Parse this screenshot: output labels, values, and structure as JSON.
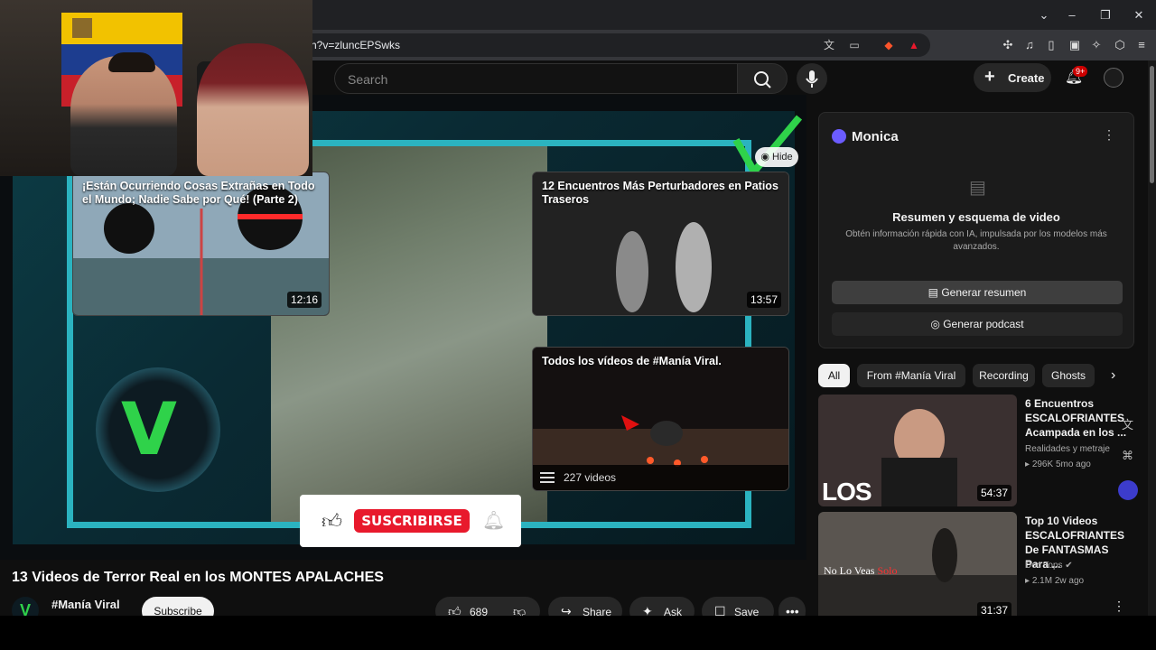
{
  "browser": {
    "url": "h?v=zluncEPSwks",
    "window_controls": {
      "dropdown": "⌄",
      "minimize": "–",
      "restore": "❐",
      "close": "✕"
    }
  },
  "header": {
    "search_placeholder": "Search",
    "create_label": "Create",
    "notifications_badge": "9+"
  },
  "player": {
    "end_cards": [
      {
        "title": "¡Están Ocurriendo Cosas Extrañas en Todo el Mundo; Nadie Sabe por Qué! (Parte 2)",
        "duration": "12:16"
      },
      {
        "title": "12 Encuentros Más Perturbadores en Patios Traseros",
        "duration": "13:57"
      },
      {
        "title": "Todos los vídeos de #Manía Viral.",
        "video_count": "227 videos"
      }
    ],
    "hide_label": "Hide",
    "subscribe_overlay": "SUSCRIBIRSE"
  },
  "video": {
    "title": "13 Videos de Terror Real en los MONTES APALACHES",
    "channel": "#Manía Viral",
    "subscribe_label": "Subscribe",
    "likes": "689",
    "share_label": "Share",
    "ask_label": "Ask",
    "save_label": "Save"
  },
  "monica": {
    "name": "Monica",
    "heading": "Resumen y esquema de video",
    "description": "Obtén información rápida con IA, impulsada por los modelos más avanzados.",
    "summary_button": "Generar resumen",
    "podcast_button": "Generar podcast"
  },
  "chips": [
    "All",
    "From #Manía Viral",
    "Recording",
    "Ghosts"
  ],
  "recommendations": [
    {
      "title": "6 Encuentros ESCALOFRIANTES Acampada en los ...",
      "channel": "Realidades y metraje",
      "views": "296K",
      "age": "5mo ago",
      "duration": "54:37",
      "thumb_text": "LOS APALACHES"
    },
    {
      "title": "Top 10 Videos ESCALOFRIANTES De FANTASMAS Para ...",
      "channel": "Doc Tops",
      "views": "2.1M",
      "age": "2w ago",
      "duration": "31:37",
      "thumb_text_a": "No Lo Veas",
      "thumb_text_b": "Solo"
    }
  ]
}
